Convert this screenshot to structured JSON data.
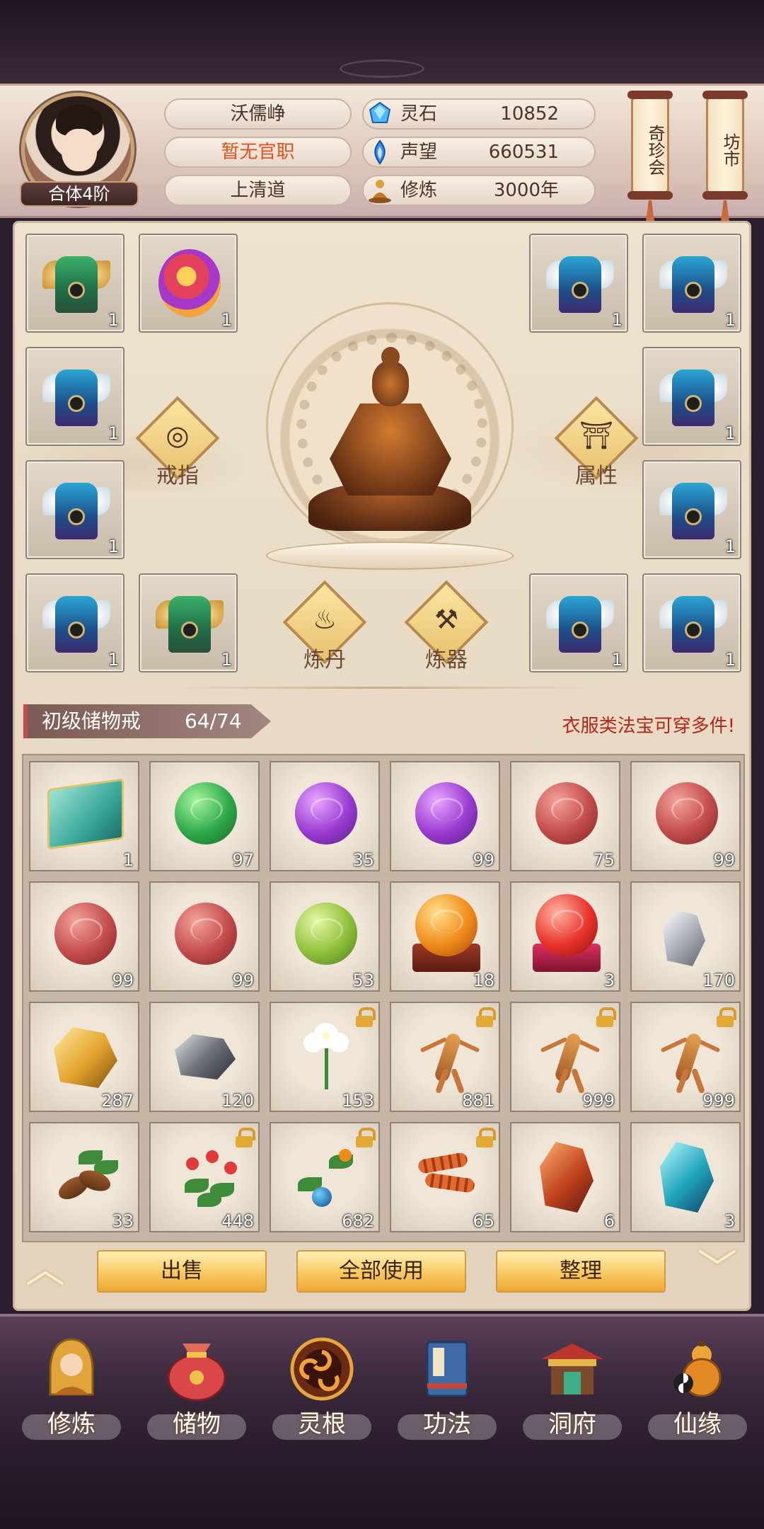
{
  "header": {
    "rank": "合体4阶",
    "player_name": "沃儒峥",
    "official_title": "暂无官职",
    "sect": "上清道",
    "stats": [
      {
        "icon": "spirit-stone-icon",
        "label": "灵石",
        "value": "10852"
      },
      {
        "icon": "reputation-icon",
        "label": "声望",
        "value": "660531"
      },
      {
        "icon": "cultivation-icon",
        "label": "修炼",
        "value": "3000年"
      }
    ],
    "side_buttons": [
      "奇珍会",
      "坊市"
    ]
  },
  "equipment": {
    "slots_left": [
      {
        "item": "armor",
        "count": "1"
      },
      {
        "item": "ring",
        "count": "1"
      },
      {
        "item": "robe",
        "count": "1"
      },
      {
        "item": "robe",
        "count": "1"
      },
      {
        "item": "robe",
        "count": "1"
      },
      {
        "item": "armor",
        "count": "1"
      }
    ],
    "slots_right": [
      {
        "item": "robe",
        "count": "1"
      },
      {
        "item": "robe",
        "count": "1"
      },
      {
        "item": "robe",
        "count": "1"
      },
      {
        "item": "robe",
        "count": "1"
      },
      {
        "item": "robe",
        "count": "1"
      },
      {
        "item": "robe",
        "count": "1"
      }
    ],
    "buttons": {
      "ring": "戒指",
      "attributes": "属性",
      "alchemy": "炼丹",
      "forging": "炼器"
    }
  },
  "bag": {
    "name": "初级储物戒",
    "capacity": "64/74",
    "hint": "衣服类法宝可穿多件!",
    "items": [
      {
        "kind": "book",
        "count": "1",
        "locked": false
      },
      {
        "kind": "orb-green",
        "count": "97",
        "locked": false
      },
      {
        "kind": "orb-purple",
        "count": "35",
        "locked": false
      },
      {
        "kind": "orb-purple",
        "count": "99",
        "locked": false
      },
      {
        "kind": "orb-red",
        "count": "75",
        "locked": false
      },
      {
        "kind": "orb-red",
        "count": "99",
        "locked": false
      },
      {
        "kind": "orb-red",
        "count": "99",
        "locked": false
      },
      {
        "kind": "orb-red",
        "count": "99",
        "locked": false
      },
      {
        "kind": "orb-lime",
        "count": "53",
        "locked": false
      },
      {
        "kind": "orb-orange-stand",
        "count": "18",
        "locked": false
      },
      {
        "kind": "orb-crimson-stand",
        "count": "3",
        "locked": false
      },
      {
        "kind": "silver-ore",
        "count": "170",
        "locked": false
      },
      {
        "kind": "gold-ore",
        "count": "287",
        "locked": false
      },
      {
        "kind": "dark-ore",
        "count": "120",
        "locked": false
      },
      {
        "kind": "white-flower",
        "count": "153",
        "locked": true
      },
      {
        "kind": "ginseng",
        "count": "881",
        "locked": true
      },
      {
        "kind": "ginseng",
        "count": "999",
        "locked": true
      },
      {
        "kind": "ginseng",
        "count": "999",
        "locked": true
      },
      {
        "kind": "root-herb",
        "count": "33",
        "locked": false
      },
      {
        "kind": "berry-herb",
        "count": "448",
        "locked": true
      },
      {
        "kind": "blue-fruit-branch",
        "count": "682",
        "locked": true
      },
      {
        "kind": "cordyceps",
        "count": "65",
        "locked": true
      },
      {
        "kind": "ruby-crystal",
        "count": "6",
        "locked": false
      },
      {
        "kind": "sapphire-crystal",
        "count": "3",
        "locked": false
      }
    ]
  },
  "actions": {
    "sell": "出售",
    "use_all": "全部使用",
    "sort": "整理"
  },
  "nav": [
    {
      "label": "修炼",
      "icon": "meditating-monk-icon"
    },
    {
      "label": "储物",
      "icon": "treasure-bag-icon"
    },
    {
      "label": "灵根",
      "icon": "spirit-root-icon"
    },
    {
      "label": "功法",
      "icon": "scripture-book-icon"
    },
    {
      "label": "洞府",
      "icon": "cave-palace-icon"
    },
    {
      "label": "仙缘",
      "icon": "gourd-icon"
    }
  ]
}
